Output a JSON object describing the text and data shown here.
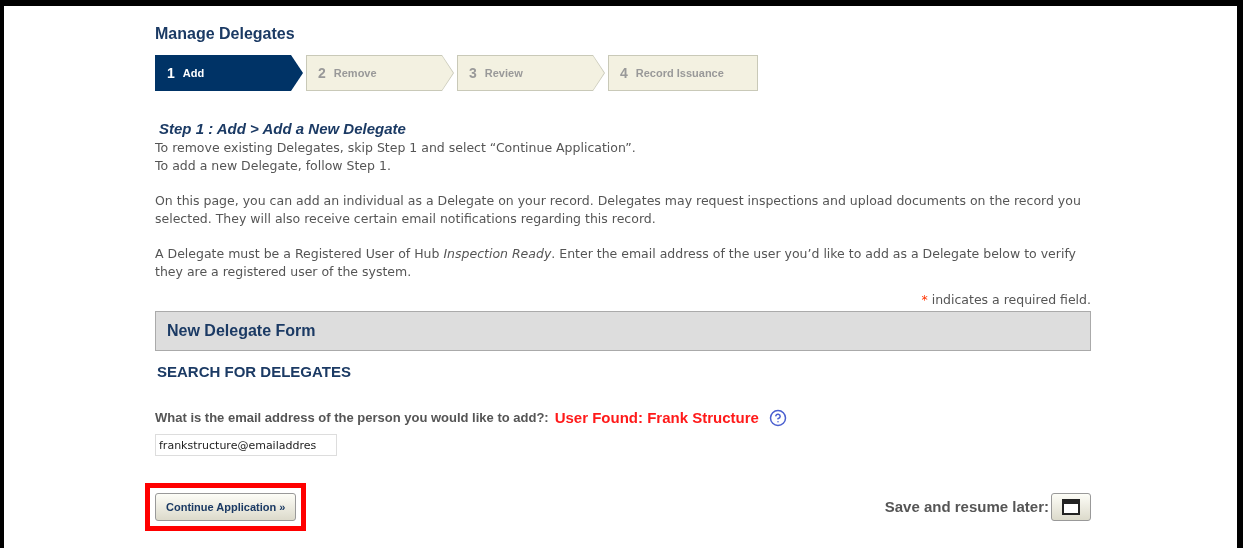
{
  "page_title": "Manage Delegates",
  "steps": [
    {
      "number": "1",
      "label": "Add",
      "selected": true
    },
    {
      "number": "2",
      "label": "Remove",
      "selected": false
    },
    {
      "number": "3",
      "label": "Review",
      "selected": false
    },
    {
      "number": "4",
      "label": "Record Issuance",
      "selected": false
    }
  ],
  "step_heading": "Step 1 : Add > Add a New Delegate",
  "intro_lines": [
    "To remove existing Delegates, skip Step 1 and select “Continue Application”.",
    "To add a new Delegate, follow Step 1."
  ],
  "paragraphs": [
    "On this page, you can add an individual as a Delegate on your record. Delegates may request inspections and upload documents on the record you selected. They will also receive certain email notifications regarding this record.",
    "A Delegate must be a Registered User of Hub *Inspection Ready*. Enter the email address of the user you’d like to add as a Delegate below to verify they are a registered user of the system."
  ],
  "required_note": {
    "mark": "*",
    "text": "indicates a required field."
  },
  "form_title": "New Delegate Form",
  "section_title": "SEARCH FOR DELEGATES",
  "email_field": {
    "label": "What is the email address of the person you would like to add?:",
    "status": "User Found: Frank Structure",
    "value": "frankstructure@emailaddres"
  },
  "continue_button": {
    "label": "Continue Application »",
    "highlighted": true
  },
  "save_label": "Save and resume later:"
}
